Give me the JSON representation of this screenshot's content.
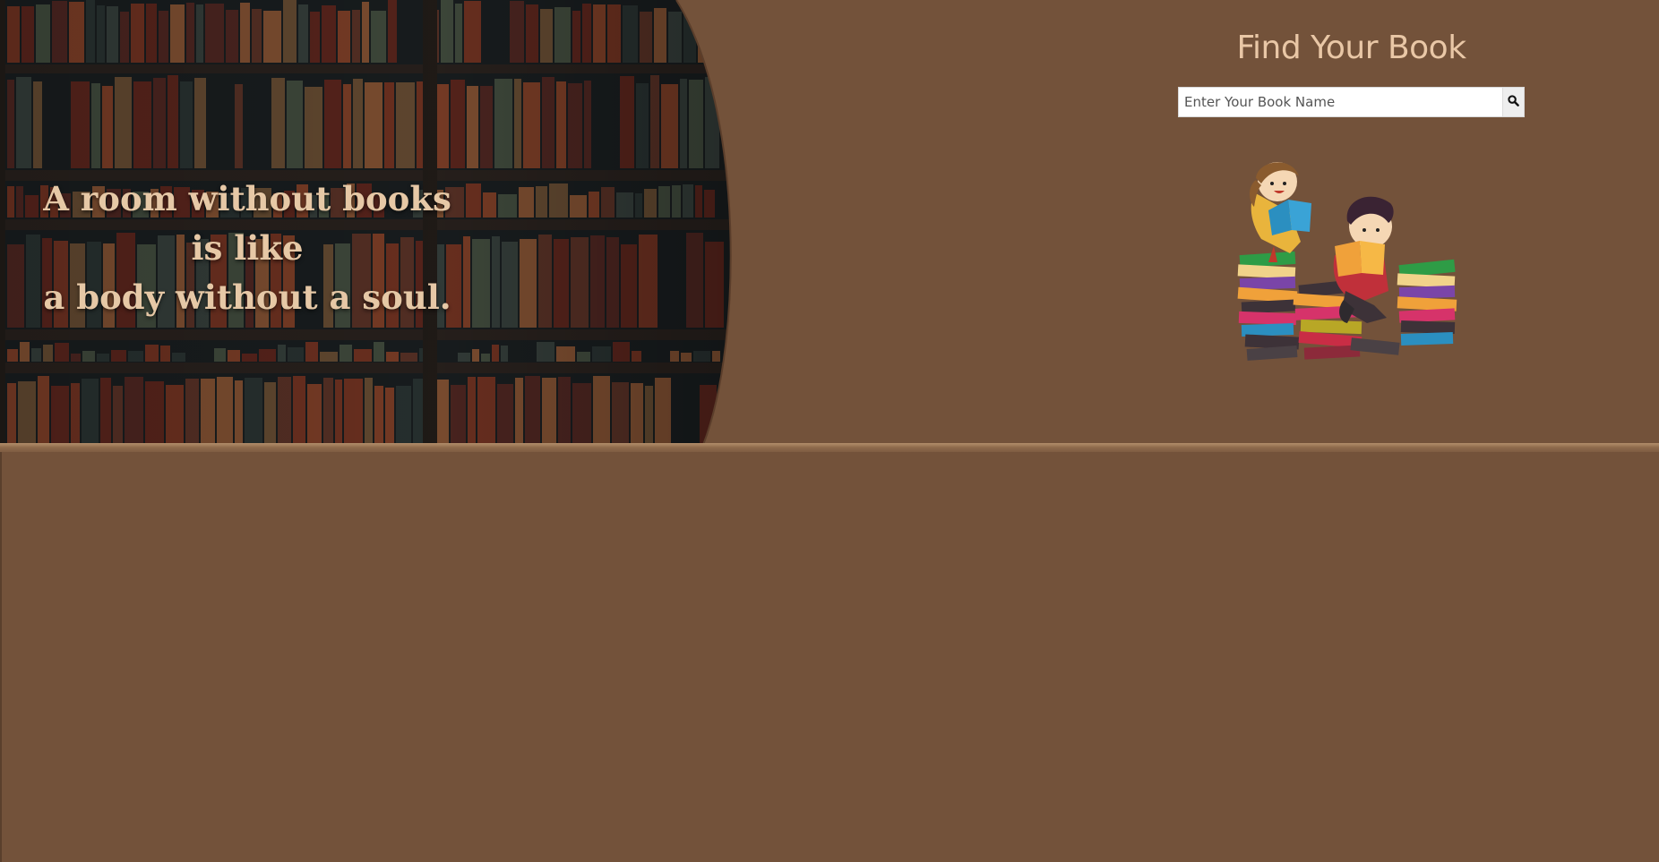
{
  "hero": {
    "quote_line1": "A room without books is like",
    "quote_line2": "a body without a soul."
  },
  "search": {
    "title": "Find Your Book",
    "placeholder": "Enter Your Book Name",
    "button_icon": "search-icon"
  },
  "illustration": {
    "name": "kids-reading-books-illustration"
  },
  "colors": {
    "background": "#73523a",
    "title": "#e9c7a6",
    "quote": "#e6c8a6"
  }
}
